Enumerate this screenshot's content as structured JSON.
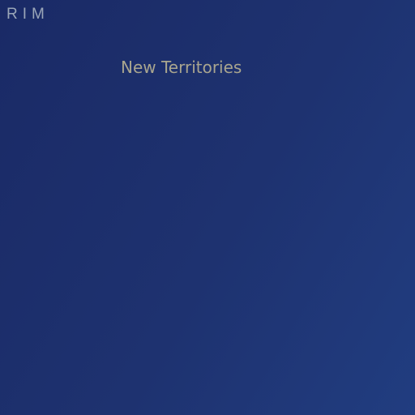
{
  "brand": {
    "text": "RIM"
  },
  "headline": {
    "text": "New Territories"
  },
  "colors": {
    "background_start": "#1a2a66",
    "background_end": "#213d80",
    "brand_text": "#9aa6b8",
    "headline_text": "#a9a58f"
  }
}
